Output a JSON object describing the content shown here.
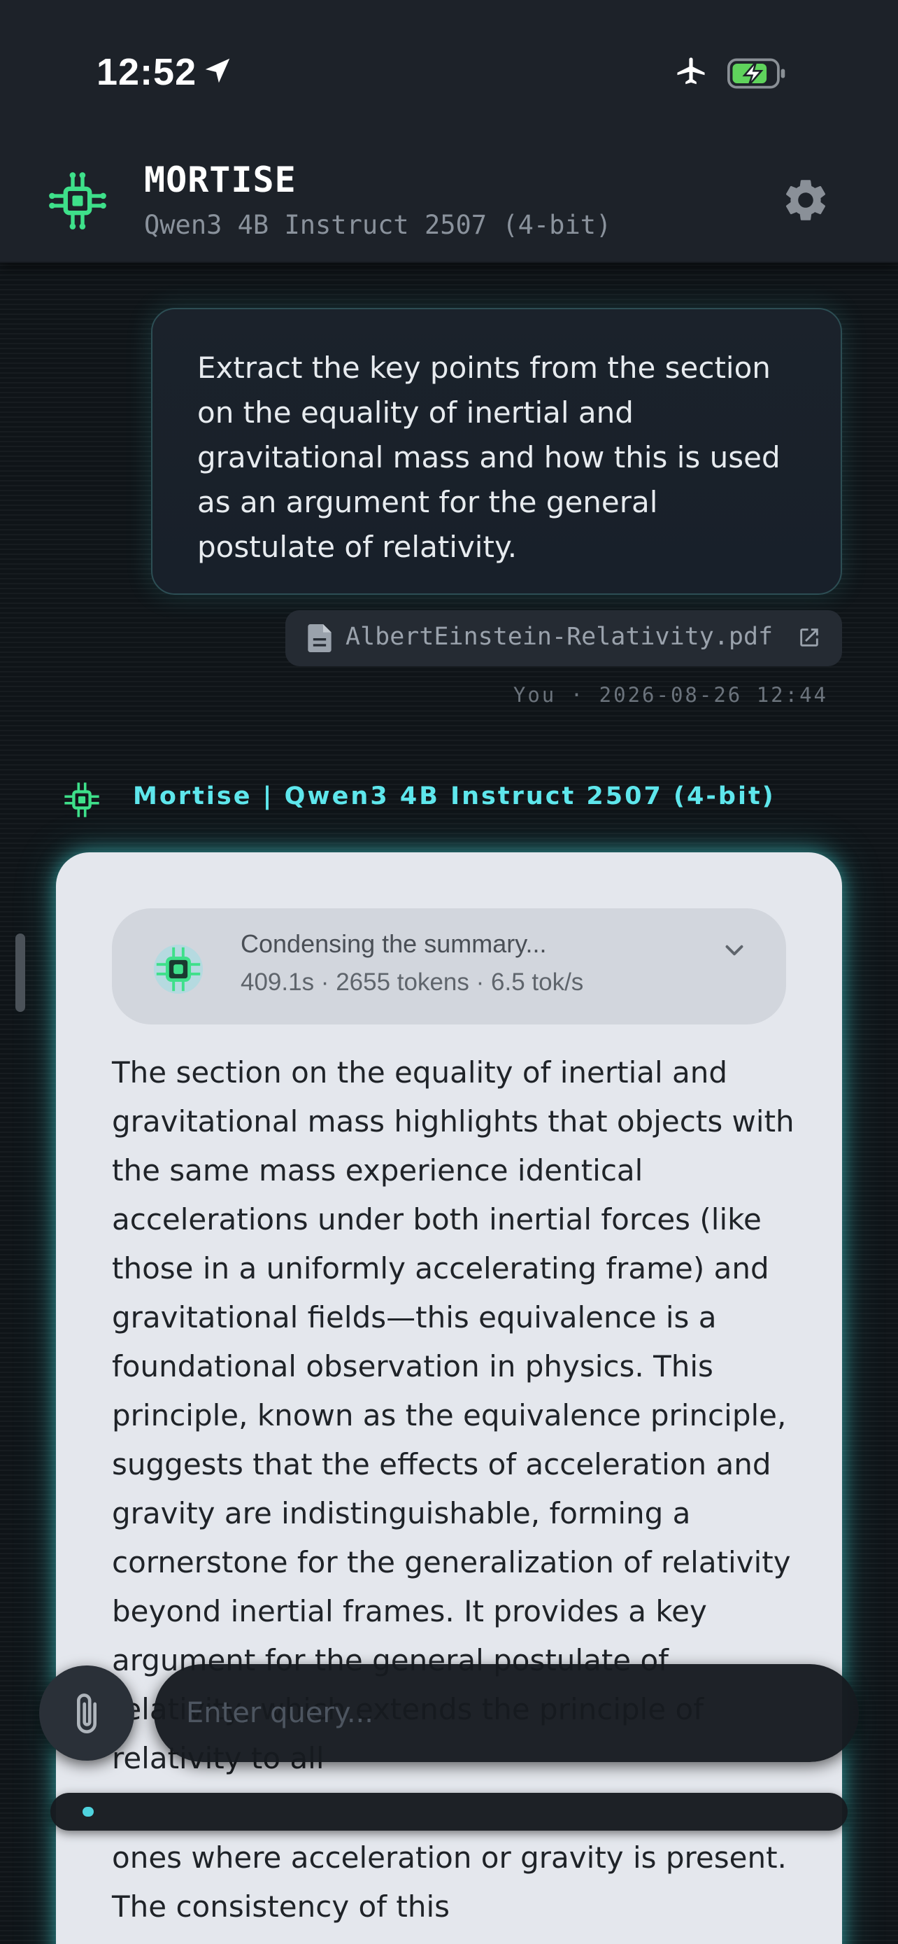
{
  "status_bar": {
    "time": "12:52",
    "icons": [
      "location-arrow-icon",
      "airplane-icon",
      "battery-charging-icon"
    ]
  },
  "header": {
    "app_name": "MORTISE",
    "model": "Qwen3 4B Instruct 2507 (4-bit)",
    "icons": [
      "chip-icon",
      "gear-icon"
    ]
  },
  "user_message": {
    "text": "Extract the key points from the section on the equality of inertial and gravitational mass and how this is used as an argument for the general postulate of relativity.",
    "attachment": "AlbertEinstein-Relativity.pdf",
    "meta": "You · 2026-08-26 12:44"
  },
  "assistant": {
    "header": "Mortise | Qwen3 4B Instruct 2507 (4-bit)",
    "thinking": {
      "status": "Condensing the summary...",
      "stats": "409.1s · 2655 tokens · 6.5 tok/s"
    },
    "response": "The section on the equality of inertial and gravitational mass highlights that objects with the same mass experience identical accelerations under both inertial forces (like those in a uniformly accelerating frame) and gravitational fields—this equivalence is a foundational observation in physics. This principle, known as the equivalence principle, suggests that the effects of acceleration and gravity are indistinguishable, forming a cornerstone for the generalization of relativity beyond inertial frames. It provides a key argument for the general postulate of relativity, which extends the principle of relativity to all",
    "response_tail": "ones where acceleration or gravity is present. The consistency of this"
  },
  "composer": {
    "placeholder": "Enter query..."
  },
  "colors": {
    "accent": "#5ee6ec",
    "chip_green": "#3ee08a",
    "background": "#0f1418",
    "card": "#e4e7ed"
  }
}
